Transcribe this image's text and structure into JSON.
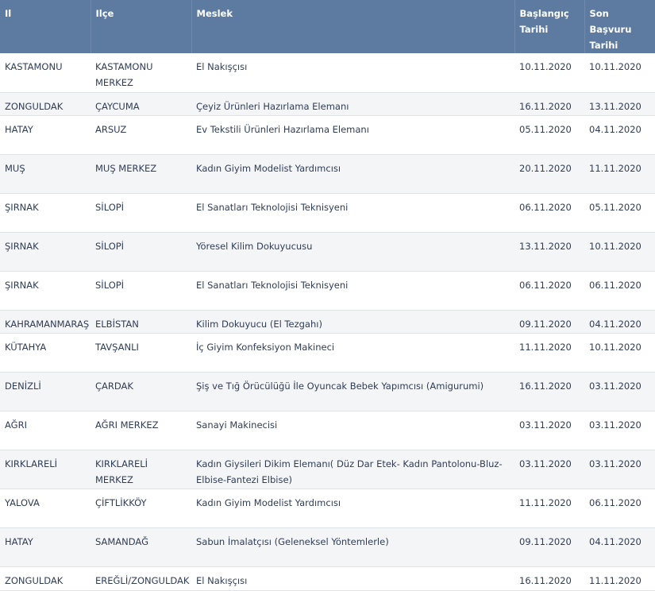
{
  "headers": {
    "il": "Il",
    "ilce": "Ilçe",
    "meslek": "Meslek",
    "baslangic": "Başlangıç Tarihi",
    "son_basvuru": "Son Başvuru Tarihi"
  },
  "rows": [
    {
      "il": "KASTAMONU",
      "ilce": "KASTAMONU MERKEZ",
      "meslek": "El Nakışçısı",
      "baslangic": "10.11.2020",
      "son_basvuru": "10.11.2020"
    },
    {
      "il": "ZONGULDAK",
      "ilce": "ÇAYCUMA",
      "meslek": "Çeyiz Ürünleri Hazırlama Elemanı",
      "baslangic": "16.11.2020",
      "son_basvuru": "13.11.2020"
    },
    {
      "il": "HATAY",
      "ilce": "ARSUZ",
      "meslek": "Ev Tekstili Ürünleri Hazırlama Elemanı",
      "baslangic": "05.11.2020",
      "son_basvuru": "04.11.2020"
    },
    {
      "il": "MUŞ",
      "ilce": "MUŞ MERKEZ",
      "meslek": "Kadın Giyim Modelist Yardımcısı",
      "baslangic": "20.11.2020",
      "son_basvuru": "11.11.2020"
    },
    {
      "il": "ŞIRNAK",
      "ilce": "SİLOPİ",
      "meslek": "El Sanatları Teknolojisi Teknisyeni",
      "baslangic": "06.11.2020",
      "son_basvuru": "05.11.2020"
    },
    {
      "il": "ŞIRNAK",
      "ilce": "SİLOPİ",
      "meslek": "Yöresel Kilim Dokuyucusu",
      "baslangic": "13.11.2020",
      "son_basvuru": "10.11.2020"
    },
    {
      "il": "ŞIRNAK",
      "ilce": "SİLOPİ",
      "meslek": "El Sanatları Teknolojisi Teknisyeni",
      "baslangic": "06.11.2020",
      "son_basvuru": "06.11.2020"
    },
    {
      "il": "KAHRAMANMARAŞ",
      "ilce": "ELBİSTAN",
      "meslek": "Kilim Dokuyucu (El Tezgahı)",
      "baslangic": "09.11.2020",
      "son_basvuru": "04.11.2020"
    },
    {
      "il": "KÜTAHYA",
      "ilce": "TAVŞANLI",
      "meslek": "İç Giyim Konfeksiyon Makineci",
      "baslangic": "11.11.2020",
      "son_basvuru": "10.11.2020"
    },
    {
      "il": "DENİZLİ",
      "ilce": "ÇARDAK",
      "meslek": "Şiş ve Tığ Örücülüğü İle Oyuncak Bebek Yapımcısı (Amigurumi)",
      "baslangic": "16.11.2020",
      "son_basvuru": "03.11.2020"
    },
    {
      "il": "AĞRI",
      "ilce": "AĞRI MERKEZ",
      "meslek": "Sanayi Makinecisi",
      "baslangic": "03.11.2020",
      "son_basvuru": "03.11.2020"
    },
    {
      "il": "KIRKLARELİ",
      "ilce": "KIRKLARELİ MERKEZ",
      "meslek": "Kadın Giysileri Dikim Elemanı( Düz Dar Etek- Kadın Pantolonu-Bluz-Elbise-Fantezi Elbise)",
      "baslangic": "03.11.2020",
      "son_basvuru": "03.11.2020"
    },
    {
      "il": "YALOVA",
      "ilce": "ÇİFTLİKKÖY",
      "meslek": "Kadın Giyim Modelist Yardımcısı",
      "baslangic": "11.11.2020",
      "son_basvuru": "06.11.2020"
    },
    {
      "il": "HATAY",
      "ilce": "SAMANDAĞ",
      "meslek": "Sabun İmalatçısı (Geleneksel Yöntemlerle)",
      "baslangic": "09.11.2020",
      "son_basvuru": "04.11.2020"
    },
    {
      "il": "ZONGULDAK",
      "ilce": "EREĞLİ/ZONGULDAK",
      "meslek": "El Nakışçısı",
      "baslangic": "16.11.2020",
      "son_basvuru": "11.11.2020"
    }
  ]
}
